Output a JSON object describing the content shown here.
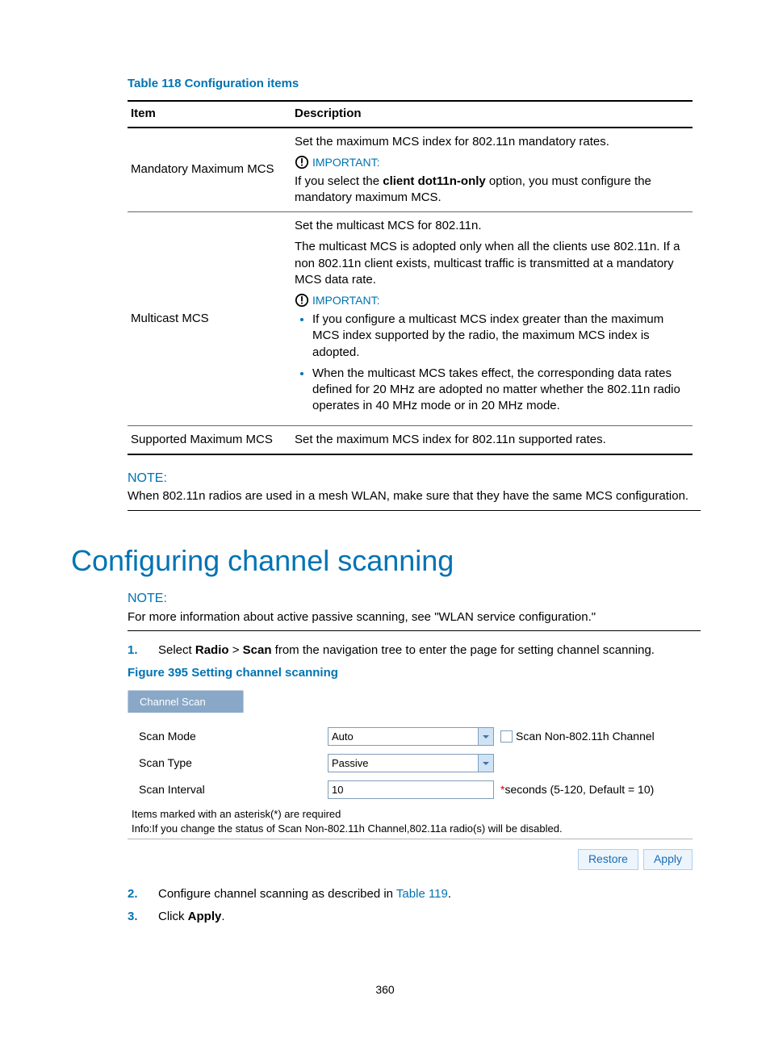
{
  "table118": {
    "caption": "Table 118 Configuration items",
    "headers": {
      "item": "Item",
      "desc": "Description"
    },
    "rows": [
      {
        "item": "Mandatory Maximum MCS",
        "intro": "Set the maximum MCS index for 802.11n mandatory rates.",
        "important_label": "IMPORTANT:",
        "important_pre": "If you select the ",
        "important_bold": "client dot11n-only",
        "important_post": " option, you must configure the mandatory maximum MCS."
      },
      {
        "item": "Multicast MCS",
        "intro1": "Set the multicast MCS for 802.11n.",
        "intro2": "The multicast MCS is adopted only when all the clients use 802.11n. If a non 802.11n client exists, multicast traffic is transmitted at a mandatory MCS data rate.",
        "important_label": "IMPORTANT:",
        "bullets": [
          "If you configure a multicast MCS index greater than the maximum MCS index supported by the radio, the maximum MCS index is adopted.",
          "When the multicast MCS takes effect, the corresponding data rates defined for 20 MHz are adopted no matter whether the 802.11n radio operates in 40 MHz mode or in 20 MHz mode."
        ]
      },
      {
        "item": "Supported Maximum MCS",
        "desc": "Set the maximum MCS index for 802.11n supported rates."
      }
    ]
  },
  "note1": {
    "label": "NOTE:",
    "text": "When 802.11n radios are used in a mesh WLAN, make sure that they have the same MCS configuration."
  },
  "heading": "Configuring channel scanning",
  "note2": {
    "label": "NOTE:",
    "text": "For more information about active passive scanning, see \"WLAN service configuration.\""
  },
  "steps": {
    "s1_pre": "Select ",
    "s1_b1": "Radio",
    "s1_mid": " > ",
    "s1_b2": "Scan",
    "s1_post": " from the navigation tree to enter the page for setting channel scanning.",
    "s2_pre": "Configure channel scanning as described in ",
    "s2_link": "Table 119",
    "s2_post": ".",
    "s3_pre": "Click ",
    "s3_b": "Apply",
    "s3_post": "."
  },
  "figure": {
    "caption": "Figure 395 Setting channel scanning",
    "tab": "Channel Scan",
    "scan_mode_label": "Scan Mode",
    "scan_mode_value": "Auto",
    "scan_mode_extra": "Scan Non-802.11h Channel",
    "scan_type_label": "Scan Type",
    "scan_type_value": "Passive",
    "scan_interval_label": "Scan Interval",
    "scan_interval_value": "10",
    "scan_interval_hint": "seconds (5-120, Default = 10)",
    "footer1": "Items marked with an asterisk(*) are required",
    "footer2": "Info:If you change the status of Scan Non-802.11h Channel,802.11a radio(s) will be disabled.",
    "btn_restore": "Restore",
    "btn_apply": "Apply"
  },
  "pagenum": "360",
  "numbers": {
    "n1": "1.",
    "n2": "2.",
    "n3": "3."
  },
  "star": "*"
}
